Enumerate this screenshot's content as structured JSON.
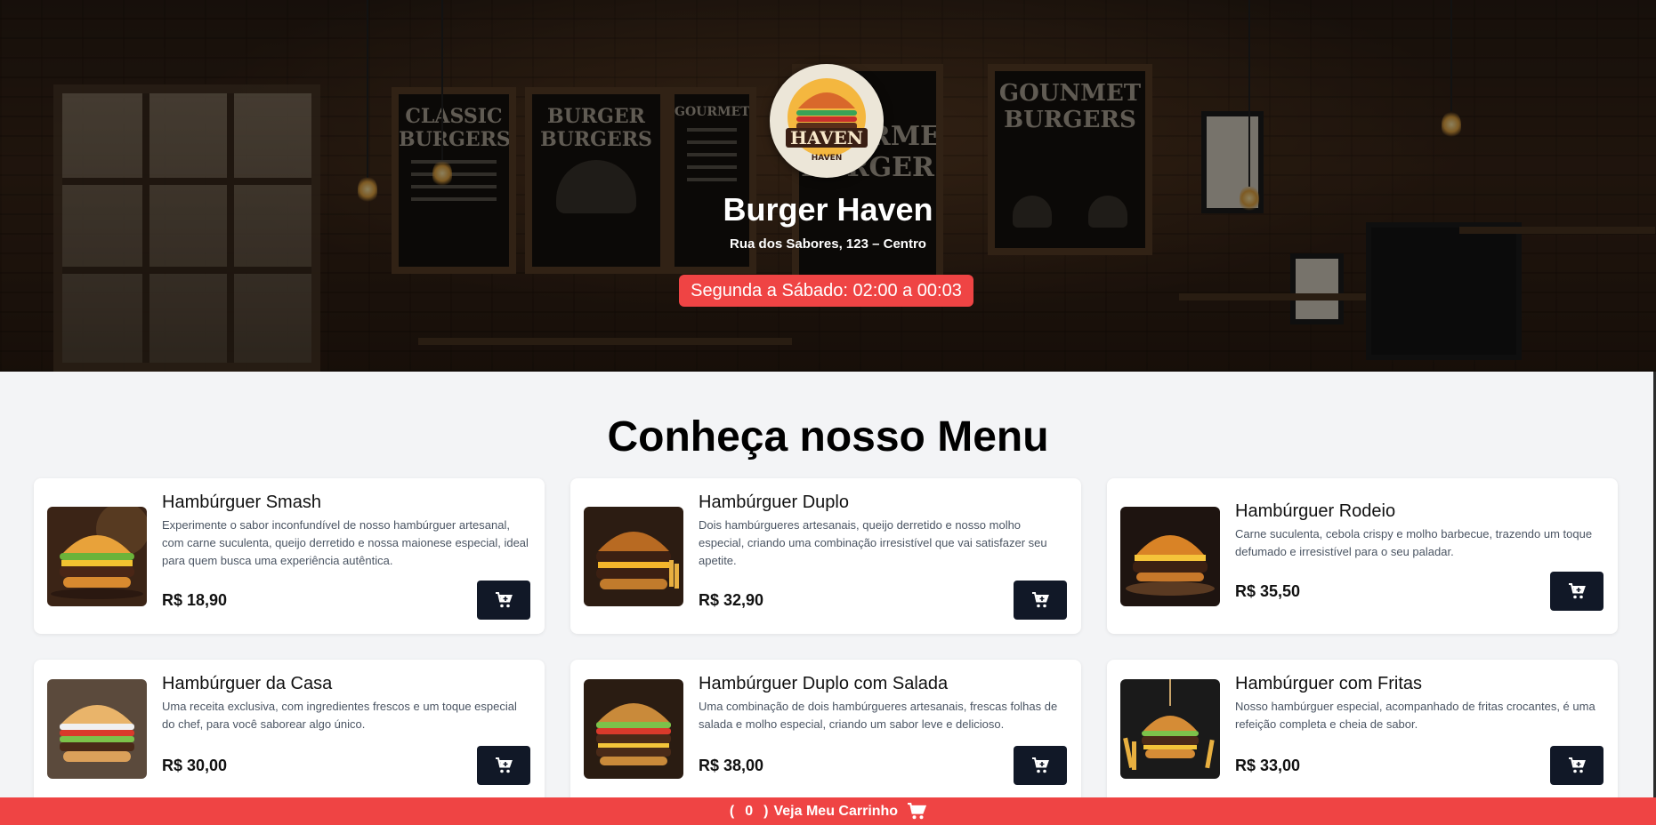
{
  "hero": {
    "logo_text": "HAVEN",
    "logo_subtext": "HAVEN",
    "title": "Burger Haven",
    "address": "Rua dos Sabores, 123 – Centro",
    "hours": "Segunda a Sábado: 02:00 a 00:03",
    "background_boards": [
      "CLASSIC BURGERS",
      "BURGER BURGERS",
      "GOURMET",
      "GOURMET BURGER",
      "GOUNMET BURGERS"
    ]
  },
  "menu": {
    "heading": "Conheça nosso Menu",
    "items": [
      {
        "name": "Hambúrguer Smash",
        "description": "Experimente o sabor inconfundível de nosso hambúrguer artesanal, com carne suculenta, queijo derretido e nossa maionese especial, ideal para quem busca uma experiência autêntica.",
        "price": "R$ 18,90"
      },
      {
        "name": "Hambúrguer Duplo",
        "description": "Dois hambúrgueres artesanais, queijo derretido e nosso molho especial, criando uma combinação irresistível que vai satisfazer seu apetite.",
        "price": "R$ 32,90"
      },
      {
        "name": "Hambúrguer Rodeio",
        "description": "Carne suculenta, cebola crispy e molho barbecue, trazendo um toque defumado e irresistível para o seu paladar.",
        "price": "R$ 35,50"
      },
      {
        "name": "Hambúrguer da Casa",
        "description": "Uma receita exclusiva, com ingredientes frescos e um toque especial do chef, para você saborear algo único.",
        "price": "R$ 30,00"
      },
      {
        "name": "Hambúrguer Duplo com Salada",
        "description": "Uma combinação de dois hambúrgueres artesanais, frescas folhas de salada e molho especial, criando um sabor leve e delicioso.",
        "price": "R$ 38,00"
      },
      {
        "name": "Hambúrguer com Fritas",
        "description": "Nosso hambúrguer especial, acompanhado de fritas crocantes, é uma refeição completa e cheia de sabor.",
        "price": "R$ 33,00"
      }
    ]
  },
  "cart_bar": {
    "open_paren": "(",
    "count": "0",
    "close_paren": ")",
    "label": "Veja Meu Carrinho",
    "icon": "cart-icon"
  },
  "colors": {
    "accent": "#ef4444",
    "button_dark": "#111827",
    "page_bg": "#f3f4f6"
  }
}
